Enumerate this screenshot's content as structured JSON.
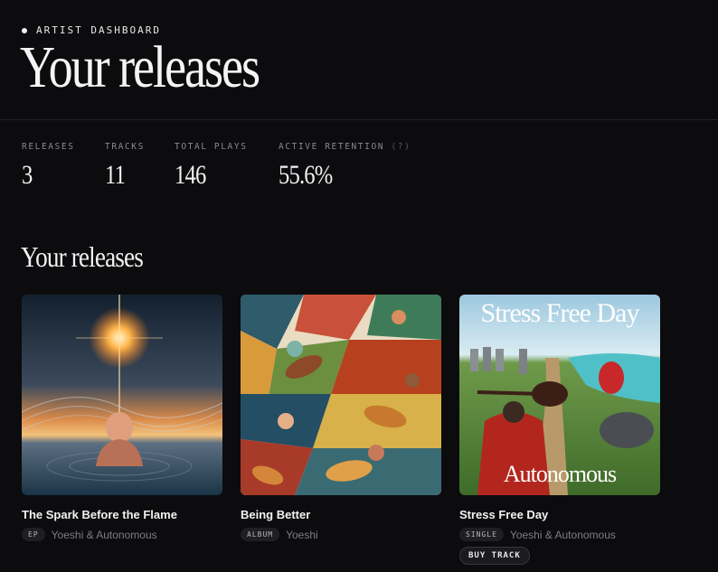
{
  "header": {
    "eyebrow": "ARTIST DASHBOARD",
    "title": "Your releases"
  },
  "stats": [
    {
      "label": "RELEASES",
      "value": "3"
    },
    {
      "label": "TRACKS",
      "value": "11"
    },
    {
      "label": "TOTAL PLAYS",
      "value": "146"
    },
    {
      "label": "ACTIVE RETENTION",
      "hint": "(?)",
      "value": "55.6%"
    }
  ],
  "section": {
    "title": "Your releases"
  },
  "releases": [
    {
      "title": "The Spark Before the Flame",
      "type": "EP",
      "artist": "Yoeshi & Autonomous"
    },
    {
      "title": "Being Better",
      "type": "ALBUM",
      "artist": "Yoeshi"
    },
    {
      "title": "Stress Free Day",
      "type": "SINGLE",
      "artist": "Yoeshi & Autonomous",
      "cover_title": "Stress Free Day",
      "cover_artist": "Autonomous",
      "action": "BUY TRACK"
    }
  ],
  "colors": {
    "background": "#0c0c0e",
    "text": "#f2f2f2",
    "muted": "#8a8a8e"
  }
}
